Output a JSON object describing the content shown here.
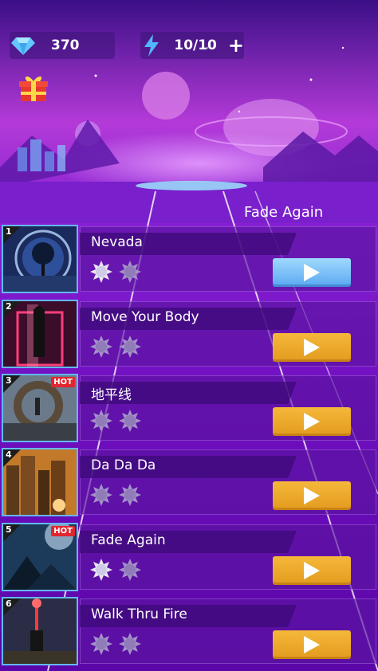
{
  "header": {
    "gems": "370",
    "energy": "10/10",
    "energy_add_label": "+"
  },
  "now_playing": "Fade Again",
  "songs": [
    {
      "rank": "1",
      "title": "Nevada",
      "stars_earned": 1,
      "stars_total": 2,
      "hot": false,
      "active": true
    },
    {
      "rank": "2",
      "title": "Move Your Body",
      "stars_earned": 0,
      "stars_total": 2,
      "hot": false,
      "active": false
    },
    {
      "rank": "3",
      "title": "地平线",
      "stars_earned": 0,
      "stars_total": 2,
      "hot": true,
      "hot_label": "HOT",
      "active": false
    },
    {
      "rank": "4",
      "title": "Da Da Da",
      "stars_earned": 0,
      "stars_total": 2,
      "hot": false,
      "active": false
    },
    {
      "rank": "5",
      "title": "Fade Again",
      "stars_earned": 1,
      "stars_total": 2,
      "hot": true,
      "hot_label": "HOT",
      "active": false
    },
    {
      "rank": "6",
      "title": "Walk Thru Fire",
      "stars_earned": 0,
      "stars_total": 2,
      "hot": false,
      "active": false
    }
  ],
  "colors": {
    "play_default": "#e8a428",
    "play_active": "#6ab8f5",
    "thumb_border": "#64b8f0",
    "hot": "#e0262e"
  }
}
